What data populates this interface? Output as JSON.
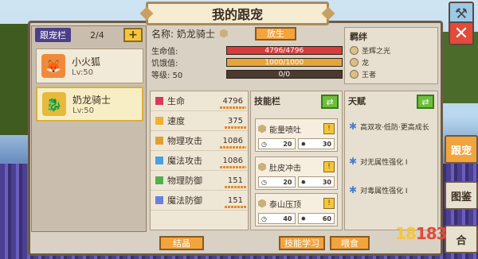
{
  "window": {
    "title": "我的跟宠"
  },
  "pet_list": {
    "title": "跟宠栏",
    "count": "2/4",
    "add_label": "+",
    "pets": [
      {
        "name": "小火狐",
        "level": "Lv:50",
        "icon": "fox-icon",
        "color": "#f08a3a"
      },
      {
        "name": "奶龙骑士",
        "level": "Lv:50",
        "icon": "dragon-knight-icon",
        "color": "#e8b93a"
      }
    ]
  },
  "pet_info": {
    "name_label": "名称: 奶龙骑士",
    "release_label": "放生",
    "stats": [
      {
        "label": "生命值:",
        "text": "4796/4796",
        "fraction": 1.0,
        "color": "#d93a3a"
      },
      {
        "label": "饥饿值:",
        "text": "1000/1000",
        "fraction": 1.0,
        "color": "#e6a53a"
      },
      {
        "label": "等级: 50",
        "text": "0/0",
        "fraction": 0.0,
        "color": "#e6a53a"
      }
    ]
  },
  "bond": {
    "title": "羁绊",
    "items": [
      "圣辉之光",
      "龙",
      "王者"
    ]
  },
  "attributes": [
    {
      "name": "生命",
      "value": "4796",
      "icon": "heart-icon",
      "color": "#d93a5a"
    },
    {
      "name": "速度",
      "value": "375",
      "icon": "speed-icon",
      "color": "#f0b030"
    },
    {
      "name": "物理攻击",
      "value": "1086",
      "icon": "physical-attack-icon",
      "color": "#e0a030"
    },
    {
      "name": "魔法攻击",
      "value": "1086",
      "icon": "magic-attack-icon",
      "color": "#4aa0e0"
    },
    {
      "name": "物理防御",
      "value": "151",
      "icon": "physical-defense-icon",
      "color": "#50b050"
    },
    {
      "name": "魔法防御",
      "value": "151",
      "icon": "magic-defense-icon",
      "color": "#6a80e0"
    }
  ],
  "skills": {
    "title": "技能栏",
    "swap_label": "⇄",
    "items": [
      {
        "name": "能量喷吐",
        "cost": "20",
        "cooldown": "30"
      },
      {
        "name": "肚皮冲击",
        "cost": "20",
        "cooldown": "30"
      },
      {
        "name": "泰山压顶",
        "cost": "40",
        "cooldown": "60"
      }
    ],
    "warn_label": "!"
  },
  "talent": {
    "title": "天赋",
    "swap_label": "⇄",
    "items": [
      "高双攻·低防·更高成长",
      "对无属性强化 I",
      "对毒属性强化 I"
    ]
  },
  "buttons": {
    "crystal": "结晶",
    "skill_learn": "技能学习",
    "feed": "喂食"
  },
  "side_tabs": {
    "pet": "跟宠",
    "guide": "图鉴",
    "fuse": "合"
  },
  "watermark": {
    "prefix": "18",
    "suffix": "183"
  }
}
